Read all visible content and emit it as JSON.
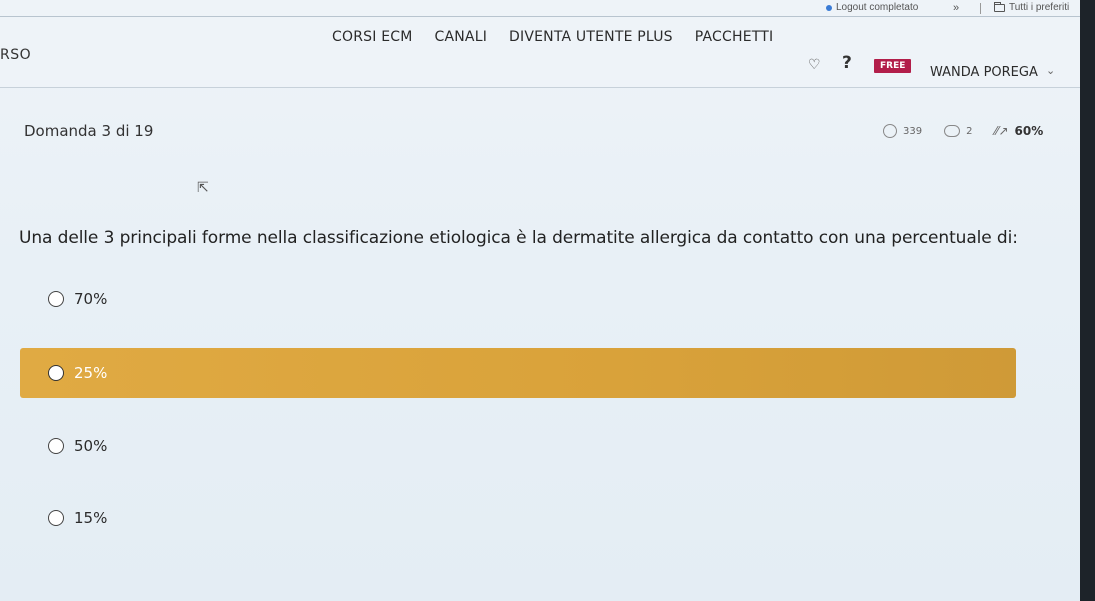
{
  "browser": {
    "bookmarks": {
      "logout": "Logout completato",
      "more": "»",
      "all_favorites": "Tutti i preferiti"
    }
  },
  "header": {
    "brand_fragment": "RSO",
    "nav": [
      "CORSI ECM",
      "CANALI",
      "DIVENTA UTENTE PLUS",
      "PACCHETTI"
    ],
    "help": "?",
    "badge": "FREE",
    "user": "WANDA POREGA"
  },
  "quiz": {
    "counter": "Domanda 3 di 19",
    "stats": {
      "time": "339",
      "comments": "2",
      "percent": "60%"
    },
    "question": "Una delle 3 principali forme nella classificazione etiologica è la dermatite allergica da contatto con una percentuale di:",
    "options": [
      {
        "label": "70%",
        "selected": false
      },
      {
        "label": "25%",
        "selected": true
      },
      {
        "label": "50%",
        "selected": false
      },
      {
        "label": "15%",
        "selected": false
      }
    ]
  },
  "colors": {
    "selected_option": "#dba440",
    "badge": "#b21e4a"
  }
}
